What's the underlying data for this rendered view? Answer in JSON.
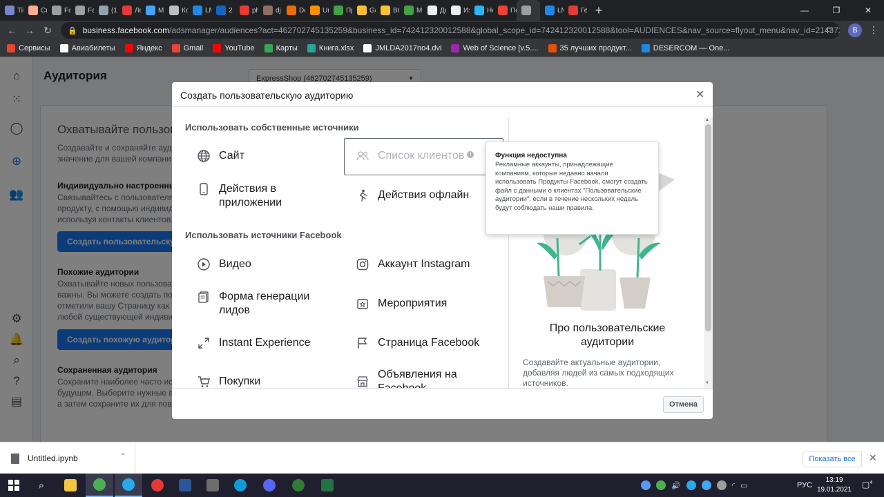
{
  "browser": {
    "tabs": [
      {
        "label": "Tii",
        "color": "#7986cb"
      },
      {
        "label": "Cr",
        "color": "#ffab91"
      },
      {
        "label": "Fa",
        "color": "#9e9e9e"
      },
      {
        "label": "Fa",
        "color": "#9e9e9e"
      },
      {
        "label": "(1:",
        "color": "#90a4ae"
      },
      {
        "label": "Ле",
        "color": "#e53935"
      },
      {
        "label": "Ма",
        "color": "#42a5f5"
      },
      {
        "label": "Ко",
        "color": "#bdbdbd"
      },
      {
        "label": "LM",
        "color": "#1e88e5"
      },
      {
        "label": "2 (",
        "color": "#1565c0"
      },
      {
        "label": "ph",
        "color": "#e53935"
      },
      {
        "label": "dj",
        "color": "#8d6e63"
      },
      {
        "label": "De",
        "color": "#ef6c00"
      },
      {
        "label": "Ur",
        "color": "#ff8f00"
      },
      {
        "label": "Пр",
        "color": "#43a047"
      },
      {
        "label": "Gc",
        "color": "#fbc02d"
      },
      {
        "label": "BL",
        "color": "#fbc02d"
      },
      {
        "label": "Ма",
        "color": "#43a047"
      },
      {
        "label": "Де",
        "color": "#eeeeee"
      },
      {
        "label": "Из",
        "color": "#eeeeee"
      },
      {
        "label": "Нс",
        "color": "#29b6f6"
      },
      {
        "label": "Пс",
        "color": "#ea4335"
      },
      {
        "label": "",
        "color": "#9e9e9e",
        "active": true
      },
      {
        "label": "LM",
        "color": "#1e88e5"
      },
      {
        "label": "Ге",
        "color": "#e53935"
      }
    ],
    "new_tab": "+",
    "url_host": "business.facebook.com",
    "url_rest": "/adsmanager/audiences?act=462702745135259&business_id=742412320012588&global_scope_id=742412320012588&tool=AUDIENCES&nav_source=flyout_menu&nav_id=214372...",
    "profile_letter": "B",
    "bookmarks": [
      {
        "label": "Сервисы",
        "color": "#ea4335"
      },
      {
        "label": "Авиабилеты",
        "color": "#ffffff"
      },
      {
        "label": "Яндекс",
        "color": "#ff0000"
      },
      {
        "label": "Gmail",
        "color": "#ea4335"
      },
      {
        "label": "YouTube",
        "color": "#ff0000"
      },
      {
        "label": "Карты",
        "color": "#34a853"
      },
      {
        "label": "Книга.xlsx",
        "color": "#26a69a"
      },
      {
        "label": "JMLDA2017no4.dvi",
        "color": "#ffffff"
      },
      {
        "label": "Web of Science [v.5....",
        "color": "#9c27b0"
      },
      {
        "label": "35 лучших продукт...",
        "color": "#e65100"
      },
      {
        "label": "DESERCOM — One...",
        "color": "#1e88e5"
      }
    ]
  },
  "page": {
    "title": "Аудитория",
    "account_select": "ExpressShop (462702745135259)",
    "bg": {
      "heading": "Охватывайте пользов",
      "intro": [
        "Создавайте и сохраняйте ауд",
        "значение для вашей компани"
      ],
      "section1_title": "Индивидуально настроенны",
      "section1_text": [
        "Связывайтесь с пользователя",
        "продукту, с помощью индивиду",
        "используя контакты клиентов, "
      ],
      "section1_button": "Создать пользовательску",
      "section2_title": "Похожие аудитории",
      "section2_text": [
        "Охватывайте новых пользоват",
        "важны. Вы можете создать пох",
        "отметили вашу Страницу как п",
        "любой существующей индивид"
      ],
      "section2_button": "Создать похожую аудитор",
      "section3_title": "Сохраненная аудитория",
      "section3_text": [
        "Сохраните наиболее часто ис",
        "будущем. Выберите нужные ва",
        "а затем сохраните их для повт"
      ]
    }
  },
  "modal": {
    "title": "Создать пользовательскую аудиторию",
    "own_sources_heading": "Использовать собственные источники",
    "fb_sources_heading": "Использовать источники Facebook",
    "own_options": [
      {
        "label": "Сайт",
        "icon": "globe-icon"
      },
      {
        "label": "Список клиентов",
        "icon": "people-icon"
      },
      {
        "label": "Действия в приложении",
        "icon": "phone-icon"
      },
      {
        "label": "Действия офлайн",
        "icon": "walker-icon"
      }
    ],
    "fb_options": [
      {
        "label": "Видео",
        "icon": "play-icon"
      },
      {
        "label": "Аккаунт Instagram",
        "icon": "instagram-icon"
      },
      {
        "label": "Форма генерации лидов",
        "icon": "form-icon"
      },
      {
        "label": "Мероприятия",
        "icon": "event-icon"
      },
      {
        "label": "Instant Experience",
        "icon": "expand-icon"
      },
      {
        "label": "Страница Facebook",
        "icon": "flag-icon"
      },
      {
        "label": "Покупки",
        "icon": "cart-icon"
      },
      {
        "label": "Объявления на Facebook",
        "icon": "shop-icon"
      }
    ],
    "right_title": "Про пользовательские аудитории",
    "right_text": "Создавайте актуальные аудитории, добавляя людей из самых подходящих источников.",
    "cancel": "Отмена",
    "tooltip_title": "Функция недоступна",
    "tooltip_body": "Рекламные аккаунты, принадлежащие компаниям, которые недавно начали использовать Продукты Facebook, смогут создать файл с данными о клиентах \"Пользовательские аудитории\", если в течение нескольких недель будут соблюдать наши правила."
  },
  "downloads": {
    "file_name": "Untitled.ipynb",
    "show_all": "Показать все"
  },
  "taskbar": {
    "lang": "РУС",
    "time": "13:19",
    "date": "19.01.2021",
    "notifications": "4"
  }
}
